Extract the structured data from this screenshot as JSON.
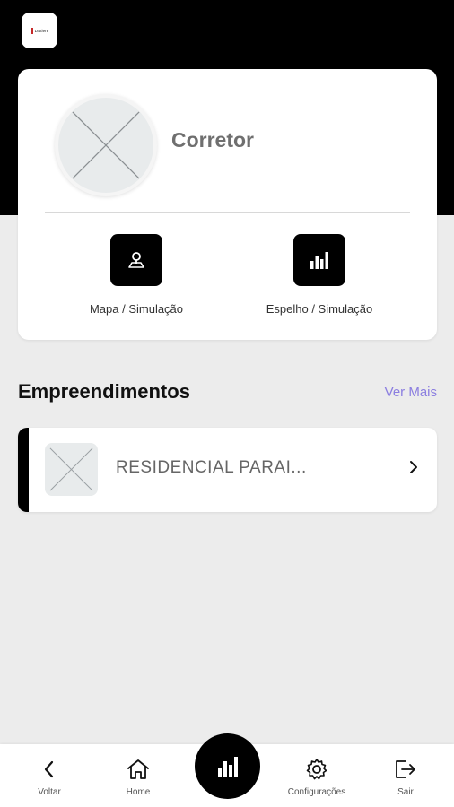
{
  "header": {
    "logo_text": "Lettiere"
  },
  "profile": {
    "name": "Corretor"
  },
  "actions": [
    {
      "label": "Mapa / Simulação",
      "icon": "map-pin-icon"
    },
    {
      "label": "Espelho / Simulação",
      "icon": "bar-chart-icon"
    }
  ],
  "section": {
    "title": "Empreendimentos",
    "see_more": "Ver Mais"
  },
  "projects": [
    {
      "name": "RESIDENCIAL PARAI..."
    }
  ],
  "bottom_nav": {
    "items": [
      {
        "label": "Voltar",
        "icon": "chevron-left-icon"
      },
      {
        "label": "Home",
        "icon": "home-icon"
      },
      {
        "label": "",
        "icon": "bar-chart-icon"
      },
      {
        "label": "Configurações",
        "icon": "gear-icon"
      },
      {
        "label": "Sair",
        "icon": "logout-icon"
      }
    ]
  },
  "colors": {
    "accent": "#000000",
    "link": "#8b7ee0",
    "background": "#ececec"
  }
}
